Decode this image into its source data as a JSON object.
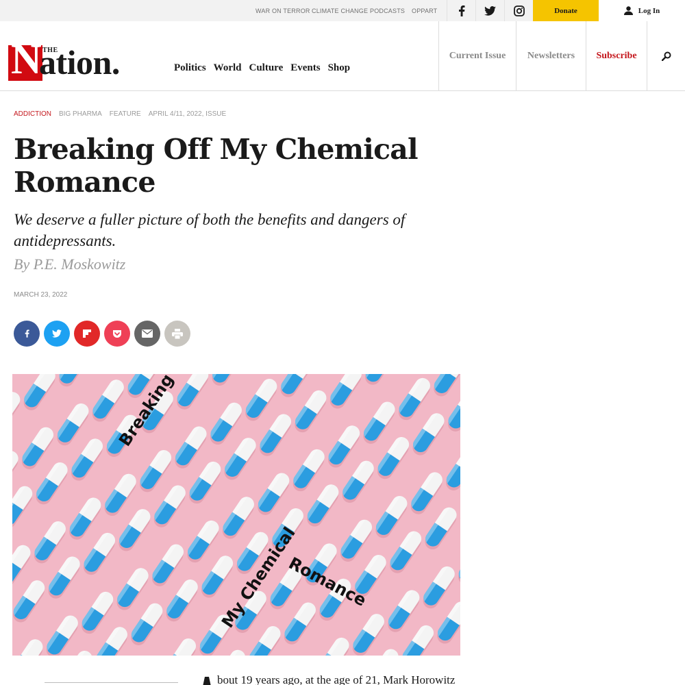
{
  "topbar": {
    "links": [
      "WAR ON TERROR",
      "CLIMATE CHANGE",
      "PODCASTS",
      "OPPART"
    ],
    "social_icons": [
      "facebook-icon",
      "twitter-icon",
      "instagram-icon"
    ],
    "donate_label": "Donate",
    "login_label": "Log In",
    "donate_color": "#f5c400"
  },
  "header": {
    "logo_the": "THE",
    "logo_n": "N",
    "logo_rest": "ation.",
    "nav": [
      "Politics",
      "World",
      "Culture",
      "Events",
      "Shop"
    ],
    "current_issue": "Current Issue",
    "newsletters": "Newsletters",
    "subscribe": "Subscribe",
    "brand_red": "#d10a11"
  },
  "article": {
    "tags": [
      "ADDICTION",
      "BIG PHARMA",
      "FEATURE",
      "APRIL 4/11, 2022, ISSUE"
    ],
    "headline": "Breaking Off My Chemical Romance",
    "dek": "We deserve a fuller picture of both the benefits and dangers of antidepressants.",
    "byline": "By P.E. Moskowitz",
    "date": "MARCH 23, 2022",
    "share_buttons": [
      {
        "icon": "facebook-icon",
        "color": "#3b5998"
      },
      {
        "icon": "twitter-icon",
        "color": "#1da1f2"
      },
      {
        "icon": "flipboard-icon",
        "color": "#e12828"
      },
      {
        "icon": "pocket-icon",
        "color": "#ef4056"
      },
      {
        "icon": "email-icon",
        "color": "#666666"
      },
      {
        "icon": "print-icon",
        "color": "#c8c5bf"
      }
    ],
    "hero_text_1": "Breaking Off",
    "hero_text_2": "My Chemical",
    "hero_text_3": "Romance",
    "body_start": "bout 19 years ago, at the age of 21, Mark Horowitz"
  }
}
